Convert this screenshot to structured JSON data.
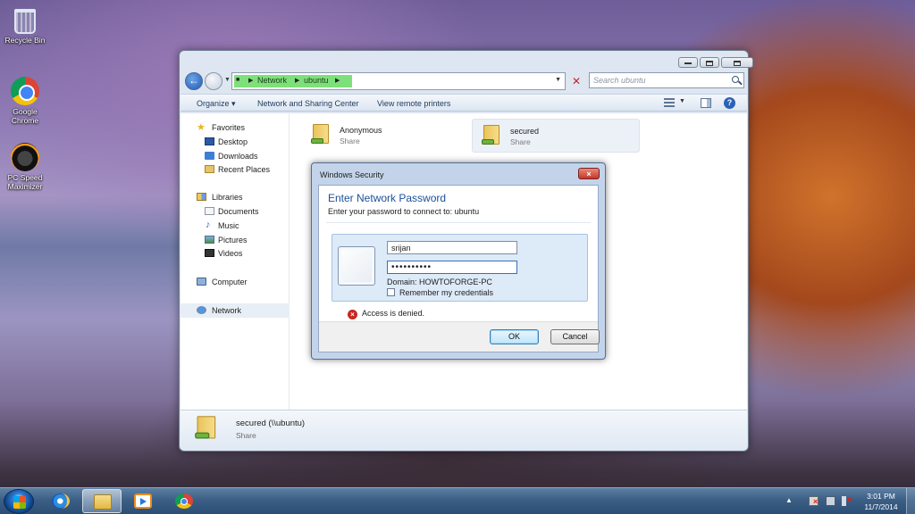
{
  "desktop": {
    "icons": [
      {
        "label": "Recycle Bin",
        "icon": "recycle-bin-icon"
      },
      {
        "label": "Google Chrome",
        "icon": "chrome-icon"
      },
      {
        "label": "PC Speed Maximizer",
        "icon": "pc-speed-maximizer-icon"
      }
    ]
  },
  "explorer": {
    "breadcrumb": [
      "Network",
      "ubuntu"
    ],
    "search_placeholder": "Search ubuntu",
    "toolbar": {
      "organize": "Organize ▾",
      "network_sharing": "Network and Sharing Center",
      "view_printers": "View remote printers"
    },
    "nav": {
      "favorites": "Favorites",
      "desktop": "Desktop",
      "downloads": "Downloads",
      "recent_places": "Recent Places",
      "libraries": "Libraries",
      "documents": "Documents",
      "music": "Music",
      "pictures": "Pictures",
      "videos": "Videos",
      "computer": "Computer",
      "network": "Network"
    },
    "items": [
      {
        "name": "Anonymous",
        "type": "Share"
      },
      {
        "name": "secured",
        "type": "Share"
      }
    ],
    "details": {
      "name": "secured (\\\\ubuntu)",
      "type": "Share"
    }
  },
  "dialog": {
    "title": "Windows Security",
    "close_label": "×",
    "heading": "Enter Network Password",
    "subtitle": "Enter your password to connect to: ubuntu",
    "username": "srijan",
    "password": "••••••••••",
    "domain": "Domain: HOWTOFORGE-PC",
    "remember": "Remember my credentials",
    "error": "Access is denied.",
    "ok": "OK",
    "cancel": "Cancel"
  },
  "taskbar": {
    "time": "3:01 PM",
    "date": "11/7/2014"
  }
}
